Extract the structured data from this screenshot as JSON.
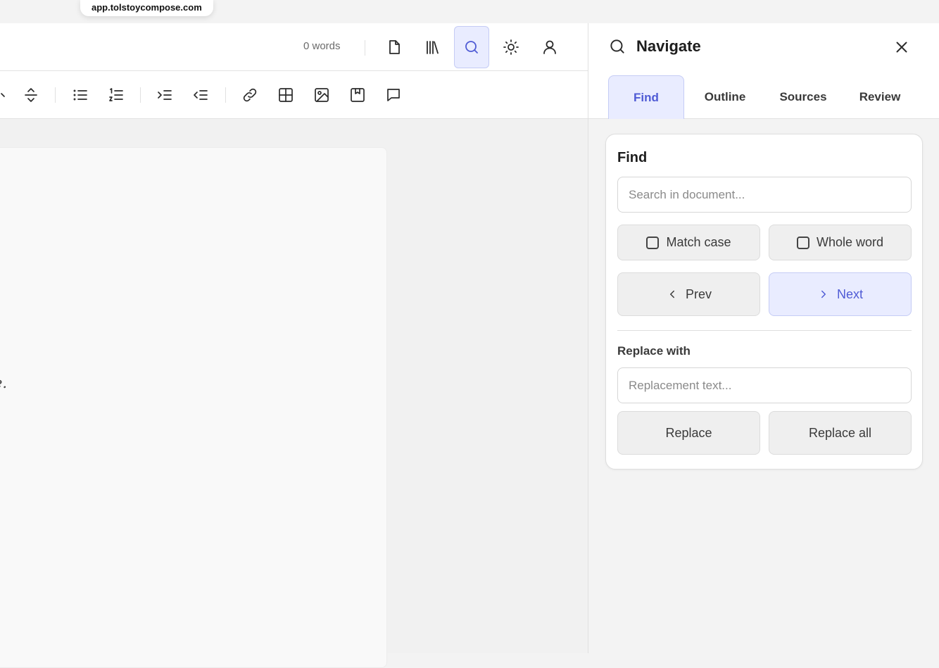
{
  "browser": {
    "url": "app.tolstoycompose.com"
  },
  "editor": {
    "word_count": "0 words",
    "page_text_fragment": "e.",
    "topbar_icons": [
      "document-icon",
      "library-icon",
      "search-icon",
      "theme-sun-icon",
      "user-icon"
    ],
    "active_tool": "search-icon",
    "format_icons": [
      "strikethrough-icon",
      "bullet-list-icon",
      "numbered-list-icon",
      "indent-icon",
      "outdent-icon",
      "link-icon",
      "table-icon",
      "image-icon",
      "bookmark-icon",
      "comment-icon"
    ]
  },
  "panel": {
    "title": "Navigate",
    "tabs": [
      {
        "label": "Find",
        "active": true
      },
      {
        "label": "Outline",
        "active": false
      },
      {
        "label": "Sources",
        "active": false
      },
      {
        "label": "Review",
        "active": false
      }
    ],
    "find": {
      "title": "Find",
      "search_placeholder": "Search in document...",
      "search_value": "",
      "match_case_label": "Match case",
      "match_case_checked": false,
      "whole_word_label": "Whole word",
      "whole_word_checked": false,
      "prev_label": "Prev",
      "next_label": "Next",
      "replace_title": "Replace with",
      "replace_placeholder": "Replacement text...",
      "replace_value": "",
      "replace_label": "Replace",
      "replace_all_label": "Replace all"
    }
  },
  "colors": {
    "accent": "#4f5bd5",
    "accent_bg": "#e9ecff",
    "accent_border": "#c5ccf5"
  }
}
